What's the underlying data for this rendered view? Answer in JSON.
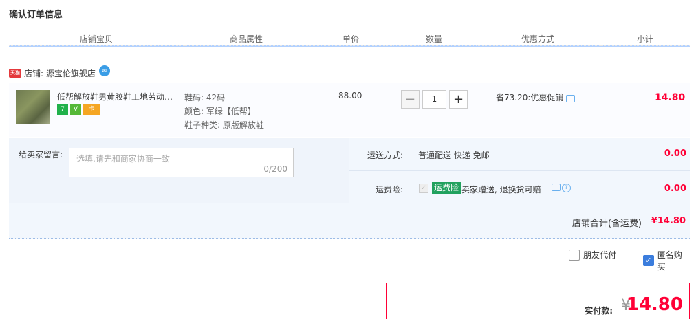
{
  "page_title": "确认订单信息",
  "table_headers": [
    "店铺宝贝",
    "商品属性",
    "单价",
    "数量",
    "优惠方式",
    "小计"
  ],
  "shop": {
    "label": "店铺: 源宝伦旗舰店",
    "tmall_badge": "天猫"
  },
  "item": {
    "title": "低帮解放鞋男黄胶鞋工地劳动工作鞋",
    "badges": [
      "7",
      "V",
      "卡"
    ],
    "props": [
      "鞋码: 42码",
      "颜色: 军绿【低帮】",
      "鞋子种类: 原版解放鞋"
    ],
    "unit_price": "88.00",
    "quantity": "1",
    "promo": "省73.20:优惠促销",
    "subtotal": "14.80"
  },
  "message": {
    "label": "给卖家留言:",
    "placeholder": "选填,请先和商家协商一致",
    "counter": "0/200"
  },
  "shipping": {
    "label": "运送方式:",
    "value": "普通配送 快递 免邮",
    "fee": "0.00"
  },
  "insurance": {
    "label": "运费险:",
    "tag": "运费险",
    "desc": "卖家赠送, 退换货可赔",
    "fee": "0.00"
  },
  "shop_total": {
    "label": "店铺合计(含运费)",
    "value": "¥14.80"
  },
  "options": {
    "friend_pay": "朋友代付",
    "anonymous": "匿名购买"
  },
  "payment": {
    "label": "实付款:",
    "currency": "¥",
    "amount": "14.80"
  }
}
